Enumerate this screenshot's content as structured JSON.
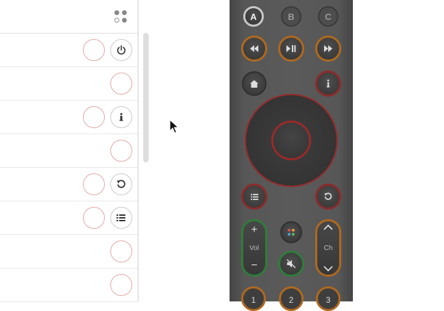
{
  "panel": {
    "header": {
      "apps_icon": "apps-grid-icon"
    },
    "rows": [
      {
        "icon": "power-icon",
        "has_a": true
      },
      {
        "icon": null,
        "has_a": false
      },
      {
        "icon": "info-icon",
        "has_a": true
      },
      {
        "icon": null,
        "has_a": false
      },
      {
        "icon": "back-arrow-icon",
        "has_a": true
      },
      {
        "icon": "list-icon",
        "has_a": true
      },
      {
        "icon": null,
        "has_a": false
      },
      {
        "icon": null,
        "has_a": false
      },
      {
        "icon": null,
        "has_a": false
      }
    ]
  },
  "remote": {
    "abc": [
      "A",
      "B",
      "C"
    ],
    "volume_label": "Vol",
    "channel_label": "Ch",
    "plus": "+",
    "minus": "−",
    "numbers": [
      "1",
      "2",
      "3"
    ],
    "colors": {
      "orange": "#b0691e",
      "red": "#8c2a2a",
      "green": "#2e7d3a",
      "body": "#575757"
    }
  }
}
